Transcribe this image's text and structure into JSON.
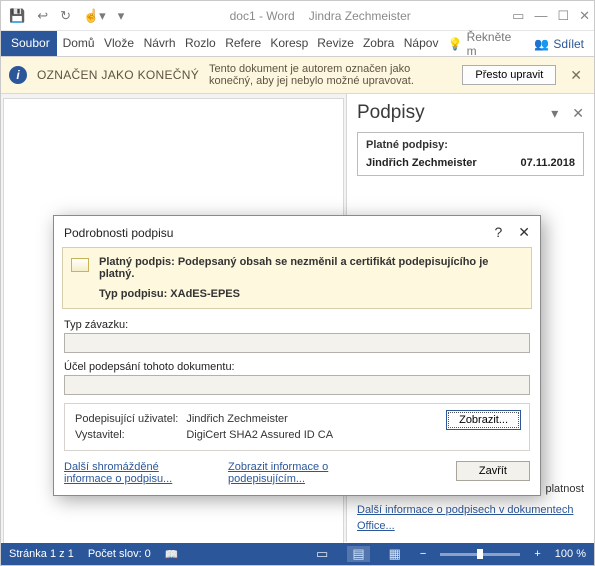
{
  "titlebar": {
    "doc_title": "doc1 - Word",
    "user_name": "Jindra Zechmeister"
  },
  "ribbon": {
    "file": "Soubor",
    "tabs": [
      "Domů",
      "Vlože",
      "Návrh",
      "Rozlo",
      "Refere",
      "Koresp",
      "Revize",
      "Zobra",
      "Nápov"
    ],
    "tell_me": "Řekněte m",
    "share": "Sdílet"
  },
  "msgbar": {
    "tag": "OZNAČEN JAKO KONEČNÝ",
    "desc": "Tento dokument je autorem označen jako konečný, aby jej nebylo možné upravovat.",
    "edit_anyway": "Přesto upravit"
  },
  "sigpanel": {
    "title": "Podpisy",
    "valid_header": "Platné podpisy:",
    "signatures": [
      {
        "name": "Jindřich Zechmeister",
        "date": "07.11.2018"
      }
    ],
    "note_tail": "platnost",
    "more_link": "Další informace o podpisech v dokumentech Office..."
  },
  "dialog": {
    "title": "Podrobnosti podpisu",
    "valid_line": "Platný podpis: Podepsaný obsah se nezměnil a certifikát podepisujícího je platný.",
    "type_label": "Typ podpisu:",
    "type_value": "XAdES-EPES",
    "commitment_label": "Typ závazku:",
    "commitment_value": "",
    "purpose_label": "Účel podepsání tohoto dokumentu:",
    "purpose_value": "",
    "signer_label": "Podepisující uživatel:",
    "signer_value": "Jindřich Zechmeister",
    "issuer_label": "Vystavitel:",
    "issuer_value": "DigiCert SHA2 Assured ID CA",
    "show_btn": "Zobrazit...",
    "link1": "Další shromážděné informace o podpisu...",
    "link2": "Zobrazit informace o podepisujícím...",
    "close_btn": "Zavřít"
  },
  "statusbar": {
    "page": "Stránka 1 z 1",
    "words": "Počet slov: 0",
    "zoom": "100 %"
  }
}
